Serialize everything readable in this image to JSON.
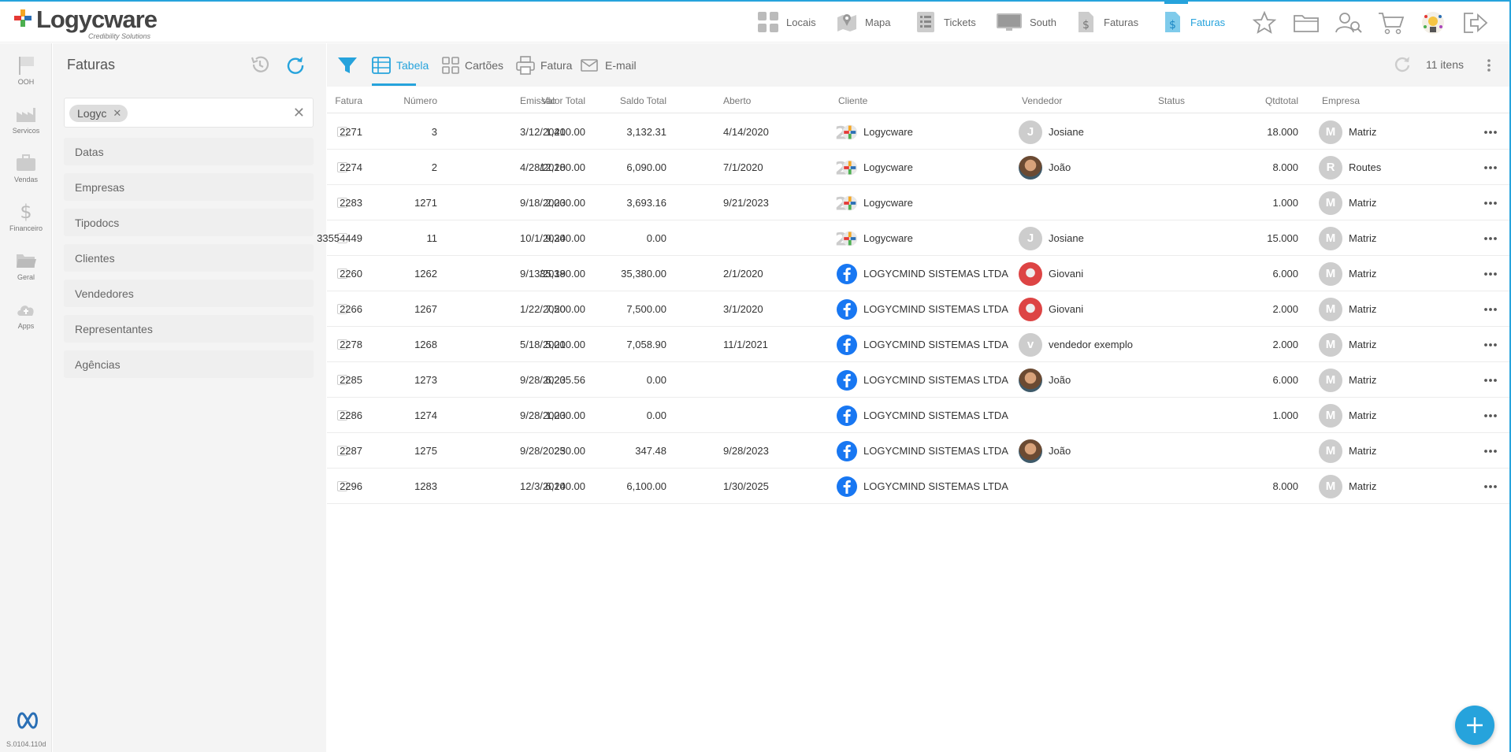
{
  "app": {
    "logo_text": "Logycware",
    "logo_sub": "Credibility Solutions",
    "version": "S.0104.110d"
  },
  "topnav": [
    {
      "label": "Locais",
      "icon": "grid-icon"
    },
    {
      "label": "Mapa",
      "icon": "map-icon"
    },
    {
      "label": "Tickets",
      "icon": "checklist-icon"
    },
    {
      "label": "South",
      "icon": "monitor-icon"
    },
    {
      "label": "Faturas",
      "icon": "invoice-icon"
    },
    {
      "label": "Faturas",
      "icon": "invoice-icon",
      "active": true
    }
  ],
  "rail": [
    {
      "label": "OOH",
      "icon": "flag-icon"
    },
    {
      "label": "Servicos",
      "icon": "factory-icon"
    },
    {
      "label": "Vendas",
      "icon": "briefcase-icon"
    },
    {
      "label": "Financeiro",
      "icon": "dollar-icon"
    },
    {
      "label": "Geral",
      "icon": "folder-icon"
    },
    {
      "label": "Apps",
      "icon": "cloud-icon"
    }
  ],
  "filter_panel": {
    "title": "Faturas",
    "chip": "Logyc",
    "facets": [
      "Datas",
      "Empresas",
      "Tipodocs",
      "Clientes",
      "Vendedores",
      "Representantes",
      "Agências"
    ]
  },
  "toolbar": {
    "tabela": "Tabela",
    "cartoes": "Cartões",
    "fatura": "Fatura",
    "email": "E-mail",
    "count": "11 itens"
  },
  "table": {
    "columns": {
      "fatura": "Fatura",
      "numero": "Número",
      "emissao": "Emissão",
      "valor_total": "Valor Total",
      "saldo_total": "Saldo Total",
      "aberto": "Aberto",
      "cliente": "Cliente",
      "vendedor": "Vendedor",
      "status": "Status",
      "qtdtotal": "Qtdtotal",
      "empresa": "Empresa"
    },
    "rows": [
      {
        "fatura": "2271",
        "numero": "3",
        "emissao": "3/12/2020",
        "valor_total": "1,410.00",
        "saldo_total": "3,132.31",
        "aberto": "4/14/2020",
        "cliente": "Logycware",
        "cliente_icon": "logycware",
        "vendedor": "Josiane",
        "vendedor_av": "J",
        "vendedor_type": "letter",
        "qtdtotal": "18.000",
        "empresa": "Matriz",
        "empresa_av": "M"
      },
      {
        "fatura": "2274",
        "numero": "2",
        "emissao": "4/28/2020",
        "valor_total": "12,180.00",
        "saldo_total": "6,090.00",
        "aberto": "7/1/2020",
        "cliente": "Logycware",
        "cliente_icon": "logycware",
        "vendedor": "João",
        "vendedor_av": "",
        "vendedor_type": "photo-j",
        "qtdtotal": "8.000",
        "empresa": "Routes",
        "empresa_av": "R"
      },
      {
        "fatura": "2283",
        "numero": "1271",
        "emissao": "9/18/2023",
        "valor_total": "2,000.00",
        "saldo_total": "3,693.16",
        "aberto": "9/21/2023",
        "cliente": "Logycware",
        "cliente_icon": "logycware",
        "vendedor": "",
        "vendedor_av": "",
        "vendedor_type": "none",
        "qtdtotal": "1.000",
        "empresa": "Matriz",
        "empresa_av": "M"
      },
      {
        "fatura": "33554449",
        "numero": "11",
        "emissao": "10/1/2024",
        "valor_total": "9,300.00",
        "saldo_total": "0.00",
        "aberto": "",
        "cliente": "Logycware",
        "cliente_icon": "logycware",
        "vendedor": "Josiane",
        "vendedor_av": "J",
        "vendedor_type": "letter",
        "qtdtotal": "15.000",
        "empresa": "Matriz",
        "empresa_av": "M"
      },
      {
        "fatura": "2260",
        "numero": "1262",
        "emissao": "9/13/2019",
        "valor_total": "35,380.00",
        "saldo_total": "35,380.00",
        "aberto": "2/1/2020",
        "cliente": "LOGYCMIND SISTEMAS LTDA",
        "cliente_icon": "facebook",
        "vendedor": "Giovani",
        "vendedor_av": "",
        "vendedor_type": "photo-g",
        "qtdtotal": "6.000",
        "empresa": "Matriz",
        "empresa_av": "M"
      },
      {
        "fatura": "2266",
        "numero": "1267",
        "emissao": "1/22/2020",
        "valor_total": "7,500.00",
        "saldo_total": "7,500.00",
        "aberto": "3/1/2020",
        "cliente": "LOGYCMIND SISTEMAS LTDA",
        "cliente_icon": "facebook",
        "vendedor": "Giovani",
        "vendedor_av": "",
        "vendedor_type": "photo-g",
        "qtdtotal": "2.000",
        "empresa": "Matriz",
        "empresa_av": "M"
      },
      {
        "fatura": "2278",
        "numero": "1268",
        "emissao": "5/18/2021",
        "valor_total": "5,000.00",
        "saldo_total": "7,058.90",
        "aberto": "11/1/2021",
        "cliente": "LOGYCMIND SISTEMAS LTDA",
        "cliente_icon": "facebook",
        "vendedor": "vendedor exemplo",
        "vendedor_av": "v",
        "vendedor_type": "letter",
        "qtdtotal": "2.000",
        "empresa": "Matriz",
        "empresa_av": "M"
      },
      {
        "fatura": "2285",
        "numero": "1273",
        "emissao": "9/28/2023",
        "valor_total": "6,205.56",
        "saldo_total": "0.00",
        "aberto": "",
        "cliente": "LOGYCMIND SISTEMAS LTDA",
        "cliente_icon": "facebook",
        "vendedor": "João",
        "vendedor_av": "",
        "vendedor_type": "photo-j",
        "qtdtotal": "6.000",
        "empresa": "Matriz",
        "empresa_av": "M"
      },
      {
        "fatura": "2286",
        "numero": "1274",
        "emissao": "9/28/2023",
        "valor_total": "1,000.00",
        "saldo_total": "0.00",
        "aberto": "",
        "cliente": "LOGYCMIND SISTEMAS LTDA",
        "cliente_icon": "facebook",
        "vendedor": "",
        "vendedor_av": "",
        "vendedor_type": "none",
        "qtdtotal": "1.000",
        "empresa": "Matriz",
        "empresa_av": "M"
      },
      {
        "fatura": "2287",
        "numero": "1275",
        "emissao": "9/28/2023",
        "valor_total": "250.00",
        "saldo_total": "347.48",
        "aberto": "9/28/2023",
        "cliente": "LOGYCMIND SISTEMAS LTDA",
        "cliente_icon": "facebook",
        "vendedor": "João",
        "vendedor_av": "",
        "vendedor_type": "photo-j",
        "qtdtotal": "",
        "empresa": "Matriz",
        "empresa_av": "M"
      },
      {
        "fatura": "2296",
        "numero": "1283",
        "emissao": "12/3/2024",
        "valor_total": "6,100.00",
        "saldo_total": "6,100.00",
        "aberto": "1/30/2025",
        "cliente": "LOGYCMIND SISTEMAS LTDA",
        "cliente_icon": "facebook",
        "vendedor": "",
        "vendedor_av": "",
        "vendedor_type": "none",
        "qtdtotal": "8.000",
        "empresa": "Matriz",
        "empresa_av": "M"
      }
    ]
  },
  "colors": {
    "accent": "#26a3dc",
    "panel": "#f4f4f4",
    "avatar_gray": "#cdcdcd",
    "facebook": "#1877f2"
  }
}
